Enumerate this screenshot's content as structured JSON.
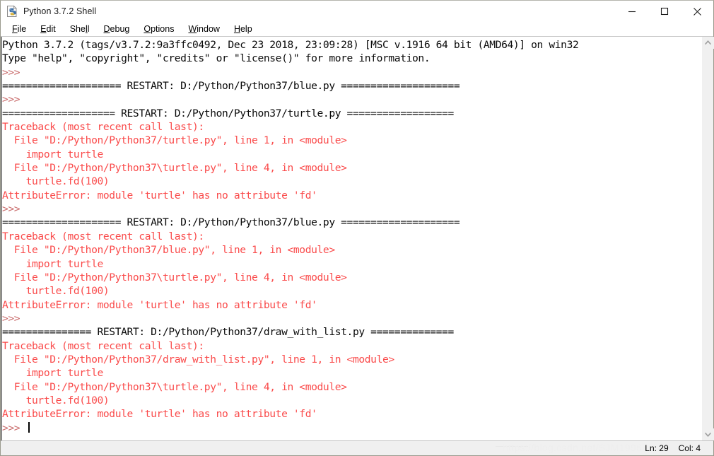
{
  "window": {
    "title": "Python 3.7.2 Shell",
    "icon": "python-file-icon",
    "controls": [
      {
        "name": "minimize-button",
        "glyph": "minimize"
      },
      {
        "name": "maximize-button",
        "glyph": "maximize"
      },
      {
        "name": "close-button",
        "glyph": "close"
      }
    ]
  },
  "menubar": {
    "items": [
      {
        "name": "file",
        "pre": "",
        "acc": "F",
        "post": "ile"
      },
      {
        "name": "edit",
        "pre": "",
        "acc": "E",
        "post": "dit"
      },
      {
        "name": "shell",
        "pre": "She",
        "acc": "l",
        "post": "l"
      },
      {
        "name": "debug",
        "pre": "",
        "acc": "D",
        "post": "ebug"
      },
      {
        "name": "options",
        "pre": "",
        "acc": "O",
        "post": "ptions"
      },
      {
        "name": "window",
        "pre": "",
        "acc": "W",
        "post": "indow"
      },
      {
        "name": "help",
        "pre": "",
        "acc": "H",
        "post": "elp"
      }
    ]
  },
  "console": {
    "lines": [
      {
        "kind": "out",
        "text": "Python 3.7.2 (tags/v3.7.2:9a3ffc0492, Dec 23 2018, 23:09:28) [MSC v.1916 64 bit (AMD64)] on win32"
      },
      {
        "kind": "out",
        "text": "Type \"help\", \"copyright\", \"credits\" or \"license()\" for more information."
      },
      {
        "kind": "prompt",
        "text": ">>> "
      },
      {
        "kind": "restart",
        "text": "==================== RESTART: D:/Python/Python37/blue.py ===================="
      },
      {
        "kind": "prompt",
        "text": ">>> "
      },
      {
        "kind": "restart",
        "text": "=================== RESTART: D:/Python/Python37/turtle.py =================="
      },
      {
        "kind": "err",
        "text": "Traceback (most recent call last):"
      },
      {
        "kind": "err",
        "text": "  File \"D:/Python/Python37/turtle.py\", line 1, in <module>"
      },
      {
        "kind": "err",
        "text": "    import turtle"
      },
      {
        "kind": "err",
        "text": "  File \"D:/Python/Python37\\turtle.py\", line 4, in <module>"
      },
      {
        "kind": "err",
        "text": "    turtle.fd(100)"
      },
      {
        "kind": "err",
        "text": "AttributeError: module 'turtle' has no attribute 'fd'"
      },
      {
        "kind": "prompt",
        "text": ">>> "
      },
      {
        "kind": "restart",
        "text": "==================== RESTART: D:/Python/Python37/blue.py ===================="
      },
      {
        "kind": "err",
        "text": "Traceback (most recent call last):"
      },
      {
        "kind": "err",
        "text": "  File \"D:/Python/Python37/blue.py\", line 1, in <module>"
      },
      {
        "kind": "err",
        "text": "    import turtle"
      },
      {
        "kind": "err",
        "text": "  File \"D:/Python/Python37\\turtle.py\", line 4, in <module>"
      },
      {
        "kind": "err",
        "text": "    turtle.fd(100)"
      },
      {
        "kind": "err",
        "text": "AttributeError: module 'turtle' has no attribute 'fd'"
      },
      {
        "kind": "prompt",
        "text": ">>> "
      },
      {
        "kind": "restart",
        "text": "=============== RESTART: D:/Python/Python37/draw_with_list.py =============="
      },
      {
        "kind": "err",
        "text": "Traceback (most recent call last):"
      },
      {
        "kind": "err",
        "text": "  File \"D:/Python/Python37/draw_with_list.py\", line 1, in <module>"
      },
      {
        "kind": "err",
        "text": "    import turtle"
      },
      {
        "kind": "err",
        "text": "  File \"D:/Python/Python37\\turtle.py\", line 4, in <module>"
      },
      {
        "kind": "err",
        "text": "    turtle.fd(100)"
      },
      {
        "kind": "err",
        "text": "AttributeError: module 'turtle' has no attribute 'fd'"
      },
      {
        "kind": "prompt",
        "text": ">>> ",
        "caret": true
      }
    ]
  },
  "scrollbar": {
    "up_arrow": "chevron-up-icon",
    "down_arrow": "chevron-down-icon"
  },
  "statusbar": {
    "line_label": "Ln: 29",
    "col_label": "Col: 4",
    "watermark": "https://blog.csdn.net/SJM1996"
  },
  "colors": {
    "error": "#fa4b4b",
    "prompt": "#c96b6b",
    "output": "#0a0a0a",
    "chrome": "#f0f0f0"
  }
}
